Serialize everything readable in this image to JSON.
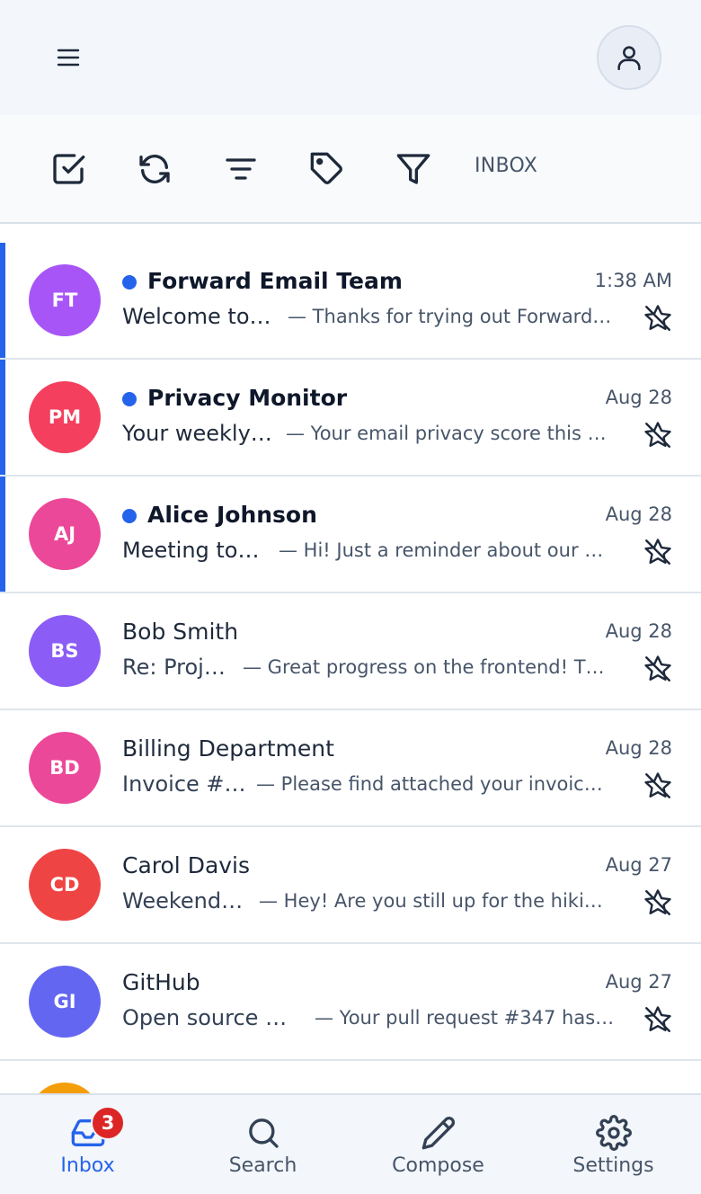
{
  "header": {
    "menu_icon": "hamburger-menu-icon",
    "account_icon": "user-icon"
  },
  "toolbar": {
    "icons": [
      "checkbox-select-icon",
      "refresh-icon",
      "sort-lines-icon",
      "tag-icon",
      "filter-funnel-icon"
    ],
    "folder_label": "INBOX"
  },
  "accent_color": "#2563eb",
  "messages": [
    {
      "initials": "FT",
      "color": "#a855f7",
      "sender": "Forward Email Team",
      "date": "1:38 AM",
      "subject": "Welcome to …",
      "preview": "— Thanks for trying out Forward…",
      "unread": true
    },
    {
      "initials": "PM",
      "color": "#f43f5e",
      "sender": "Privacy Monitor",
      "date": "Aug 28",
      "subject": "Your weekly…",
      "preview": "— Your email privacy score this …",
      "unread": true
    },
    {
      "initials": "AJ",
      "color": "#ec4899",
      "sender": "Alice Johnson",
      "date": "Aug 28",
      "subject": "Meeting to…",
      "preview": "— Hi! Just a reminder about our …",
      "unread": true
    },
    {
      "initials": "BS",
      "color": "#8b5cf6",
      "sender": "Bob Smith",
      "date": "Aug 28",
      "subject": "Re: Proj…",
      "preview": "— Great progress on the frontend! T…",
      "unread": false
    },
    {
      "initials": "BD",
      "color": "#ec4899",
      "sender": "Billing Department",
      "date": "Aug 28",
      "subject": "Invoice #…",
      "preview": "— Please find attached your invoic…",
      "unread": false
    },
    {
      "initials": "CD",
      "color": "#ef4444",
      "sender": "Carol Davis",
      "date": "Aug 27",
      "subject": "Weekend …",
      "preview": "— Hey! Are you still up for the hiki…",
      "unread": false
    },
    {
      "initials": "GI",
      "color": "#6366f1",
      "sender": "GitHub",
      "date": "Aug 27",
      "subject": "Open source c…",
      "preview": "— Your pull request #347 has…",
      "unread": false
    },
    {
      "initials": "",
      "color": "#f59e0b",
      "sender": "",
      "date": "",
      "subject": "",
      "preview": "",
      "unread": false
    }
  ],
  "bottom_nav": [
    {
      "label": "Inbox",
      "icon": "inbox-tray-icon",
      "badge": "3",
      "active": true
    },
    {
      "label": "Search",
      "icon": "search-icon",
      "active": false
    },
    {
      "label": "Compose",
      "icon": "pencil-icon",
      "active": false
    },
    {
      "label": "Settings",
      "icon": "gear-icon",
      "active": false
    }
  ]
}
